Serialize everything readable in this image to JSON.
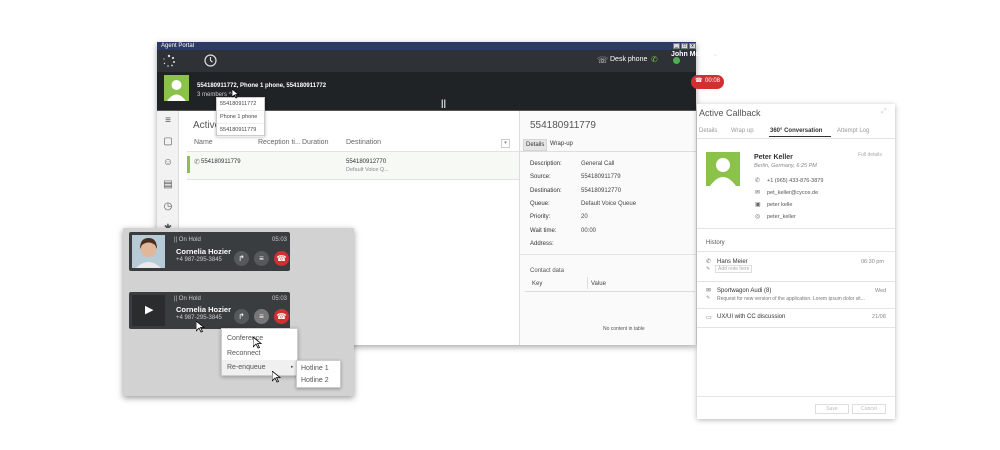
{
  "main_window": {
    "title": "Agent Portal",
    "desk_phone": "Desk phone",
    "user": "John McFly",
    "call_title": "554180911772, Phone 1 phone, 554180911772",
    "members": "3 members",
    "end_call_time": "00:08",
    "members_dropdown": [
      "554180911772",
      "Phone 1 phone",
      "554180911779"
    ],
    "table": {
      "heading": "Active",
      "columns": [
        "Name",
        "Reception ti...",
        "Duration",
        "Destination"
      ],
      "rows": [
        {
          "name": "554180911779",
          "destination": "554180912770",
          "destination_sub": "Default Voice Q..."
        }
      ]
    },
    "detail": {
      "title": "554180911779",
      "tabs": [
        "Details",
        "Wrap-up"
      ],
      "fields": [
        {
          "label": "Description:",
          "value": "General Call"
        },
        {
          "label": "Source:",
          "value": "554180911779"
        },
        {
          "label": "Destination:",
          "value": "554180912770"
        },
        {
          "label": "Queue:",
          "value": "Default Voice Queue"
        },
        {
          "label": "Priority:",
          "value": "20"
        },
        {
          "label": "Wait time:",
          "value": "00:00"
        },
        {
          "label": "Address:",
          "value": ""
        }
      ],
      "contact_data_title": "Contact data",
      "contact_columns": [
        "Key",
        "Value"
      ],
      "empty_text": "No content in table"
    }
  },
  "callback": {
    "title": "Active Callback",
    "tabs": [
      "Details",
      "Wrap up",
      "360° Conversation",
      "Attempt Log"
    ],
    "active_tab": "360° Conversation",
    "contact": {
      "name": "Peter Keller",
      "location": "Berlin, Germany, 6:25 PM",
      "full_details": "Full details",
      "phone": "+1 (965) 433-876-3879",
      "email": "pet_keller@cycos.de",
      "handle1": "peter kelle",
      "handle2": "peter_keller"
    },
    "history_title": "History",
    "history": [
      {
        "title": "Hans Meier",
        "sub": "Add note here",
        "time": "06:30 pm"
      },
      {
        "title": "Sportwagon Audi (8)",
        "sub": "Request for new version of the application. Lorem ipsum dolor sit...",
        "time": "Wed"
      },
      {
        "title": "UX/UI with CC discussion",
        "sub": "",
        "time": "21/08"
      }
    ],
    "buttons": [
      "Save",
      "Cancel"
    ]
  },
  "hold_panel": {
    "cards": [
      {
        "status": "On Hold",
        "time": "05:03",
        "name": "Cornelia Hozier",
        "phone": "+4 987-295-3845"
      },
      {
        "status": "On Hold",
        "time": "05:03",
        "name": "Cornelia Hozier",
        "phone": "+4 987-295-3845"
      }
    ],
    "menu": [
      "Conference",
      "Reconnect",
      "Re-enqueue"
    ],
    "submenu": [
      "Hotline 1",
      "Hotline 2"
    ]
  }
}
